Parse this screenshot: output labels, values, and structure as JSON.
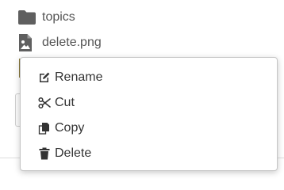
{
  "files": [
    {
      "name": "topics",
      "icon": "folder-icon"
    },
    {
      "name": "delete.png",
      "icon": "image-file-icon"
    }
  ],
  "context_menu": {
    "items": [
      {
        "label": "Rename",
        "icon": "pencil-edit-icon"
      },
      {
        "label": "Cut",
        "icon": "scissors-icon"
      },
      {
        "label": "Copy",
        "icon": "copy-icon"
      },
      {
        "label": "Delete",
        "icon": "trash-icon"
      }
    ]
  },
  "colors": {
    "icon": "#555555",
    "text": "#333333",
    "menu_border": "#c6c6c6"
  }
}
